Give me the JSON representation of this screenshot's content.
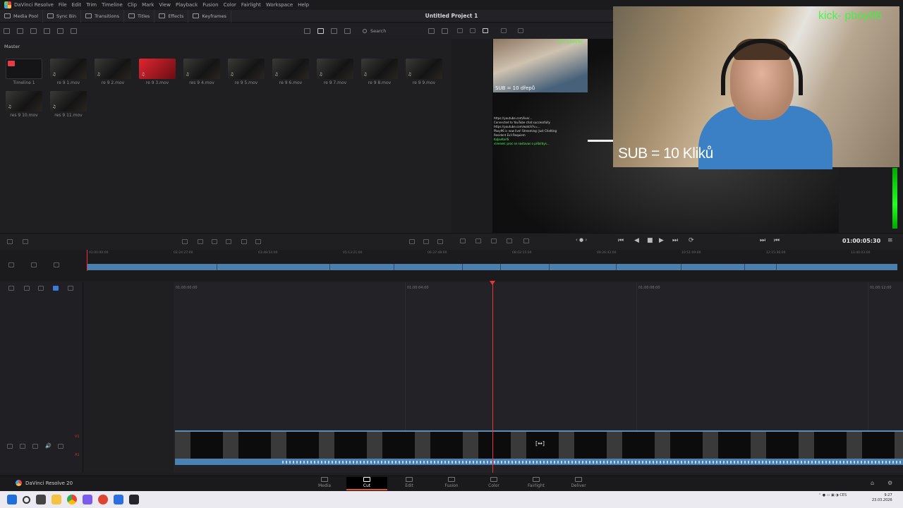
{
  "menubar": {
    "app_name": "DaVinci Resolve",
    "items": [
      "File",
      "Edit",
      "Trim",
      "Timeline",
      "Clip",
      "Mark",
      "View",
      "Playback",
      "Fusion",
      "Color",
      "Fairlight",
      "Workspace",
      "Help"
    ]
  },
  "toolbar": {
    "buttons": [
      "Media Pool",
      "Sync Bin",
      "Transitions",
      "Titles",
      "Effects",
      "Keyframes"
    ]
  },
  "project": {
    "title": "Untitled Project 1"
  },
  "search": {
    "placeholder": "Search"
  },
  "pool": {
    "title": "Master",
    "clips": [
      {
        "label": "Timeline 1",
        "style": "tl"
      },
      {
        "label": "re 9 1.mov",
        "style": "dark"
      },
      {
        "label": "re 9 2.mov",
        "style": "dark"
      },
      {
        "label": "re 9 3.mov",
        "style": "red"
      },
      {
        "label": "res 9 4.mov",
        "style": "dark"
      },
      {
        "label": "re 9 5.mov",
        "style": "dark"
      },
      {
        "label": "re 9 6.mov",
        "style": "dark"
      },
      {
        "label": "re 9 7.mov",
        "style": "dark"
      },
      {
        "label": "re 9 8.mov",
        "style": "dark"
      },
      {
        "label": "re 9 9.mov",
        "style": "dark"
      },
      {
        "label": "res 9 10.mov",
        "style": "dark"
      },
      {
        "label": "res 9 11.mov",
        "style": "dark"
      }
    ]
  },
  "viewer": {
    "pip_sub": "SUB = 10 dřepů",
    "pip_green": "kick.pboy96",
    "chat_lines": [
      "https://youtube.com/live/...",
      "Connected to YouTube chat successfully",
      "https://youtube.com/watch?v=...",
      "Pboy96 is now live! Streaming: Just Chatting",
      "Resident Evil Requiem",
      "KaJavKarlS",
      "vinenek: proc se nastavas o pribirbys..."
    ],
    "sub_main": "SUB = 10 Kliků",
    "kick_tag": "kick- pboy96",
    "timecode": "01:00:05:30"
  },
  "timeline_upper": {
    "ticks": [
      "01:00:00:00",
      "02:24:27:00",
      "03:48:54:00",
      "05:13:21:00",
      "06:37:48:00",
      "08:02:15:00",
      "09:26:42:00",
      "10:51:09:00",
      "12:15:36:00",
      "13:40:03:00"
    ]
  },
  "timeline_lower": {
    "ticks": [
      "01:00:00:00",
      "01:00:04:00",
      "01:00:08:00",
      "01:00:12:00"
    ],
    "track_v1": "V1",
    "track_a1": "A1"
  },
  "pages": [
    "Media",
    "Cut",
    "Edit",
    "Fusion",
    "Color",
    "Fairlight",
    "Deliver"
  ],
  "active_page": "Cut",
  "brand": "DaVinci Resolve 20",
  "taskbar": {
    "lang": "CES",
    "time": "9:27",
    "date": "23.03.2026"
  }
}
